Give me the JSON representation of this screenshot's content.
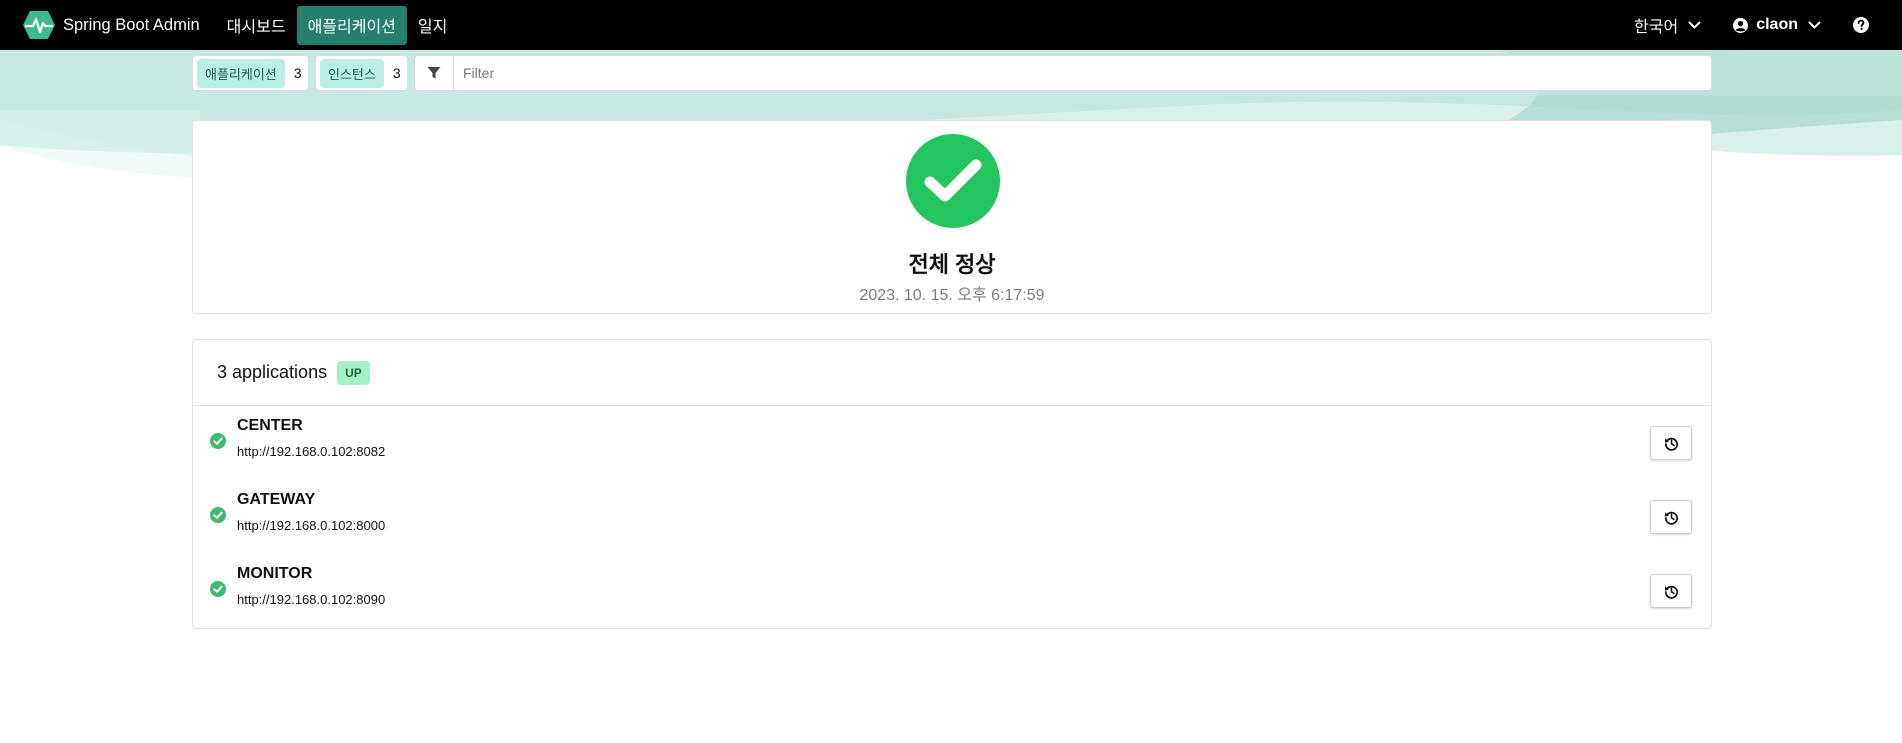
{
  "navbar": {
    "brand": "Spring Boot Admin",
    "items": [
      {
        "label": "대시보드"
      },
      {
        "label": "애플리케이션"
      },
      {
        "label": "일지"
      }
    ],
    "language": "한국어",
    "user": "claon"
  },
  "filterbar": {
    "applications": {
      "label": "애플리케이션",
      "count": "3"
    },
    "instances": {
      "label": "인스턴스",
      "count": "3"
    },
    "filter_placeholder": "Filter"
  },
  "status": {
    "title": "전체 정상",
    "timestamp": "2023. 10. 15. 오후 6:17:59"
  },
  "applications": {
    "header": "3 applications",
    "status_badge": "UP",
    "items": [
      {
        "name": "CENTER",
        "url": "http://192.168.0.102:8082"
      },
      {
        "name": "GATEWAY",
        "url": "http://192.168.0.102:8000"
      },
      {
        "name": "MONITOR",
        "url": "http://192.168.0.102:8090"
      }
    ]
  },
  "colors": {
    "navbar_bg": "#000000",
    "active_nav": "#267f6d",
    "success_green": "#22c55e",
    "chip_tag_bg": "#b9efe4",
    "up_badge_bg": "#a6f0c5"
  },
  "icons": {
    "brand": "heartbeat-hexagon-icon",
    "chevron": "chevron-down-icon",
    "user": "user-circle-icon",
    "help": "question-circle-icon",
    "filter": "filter-icon",
    "status": "check-circle-icon",
    "history": "history-icon"
  }
}
